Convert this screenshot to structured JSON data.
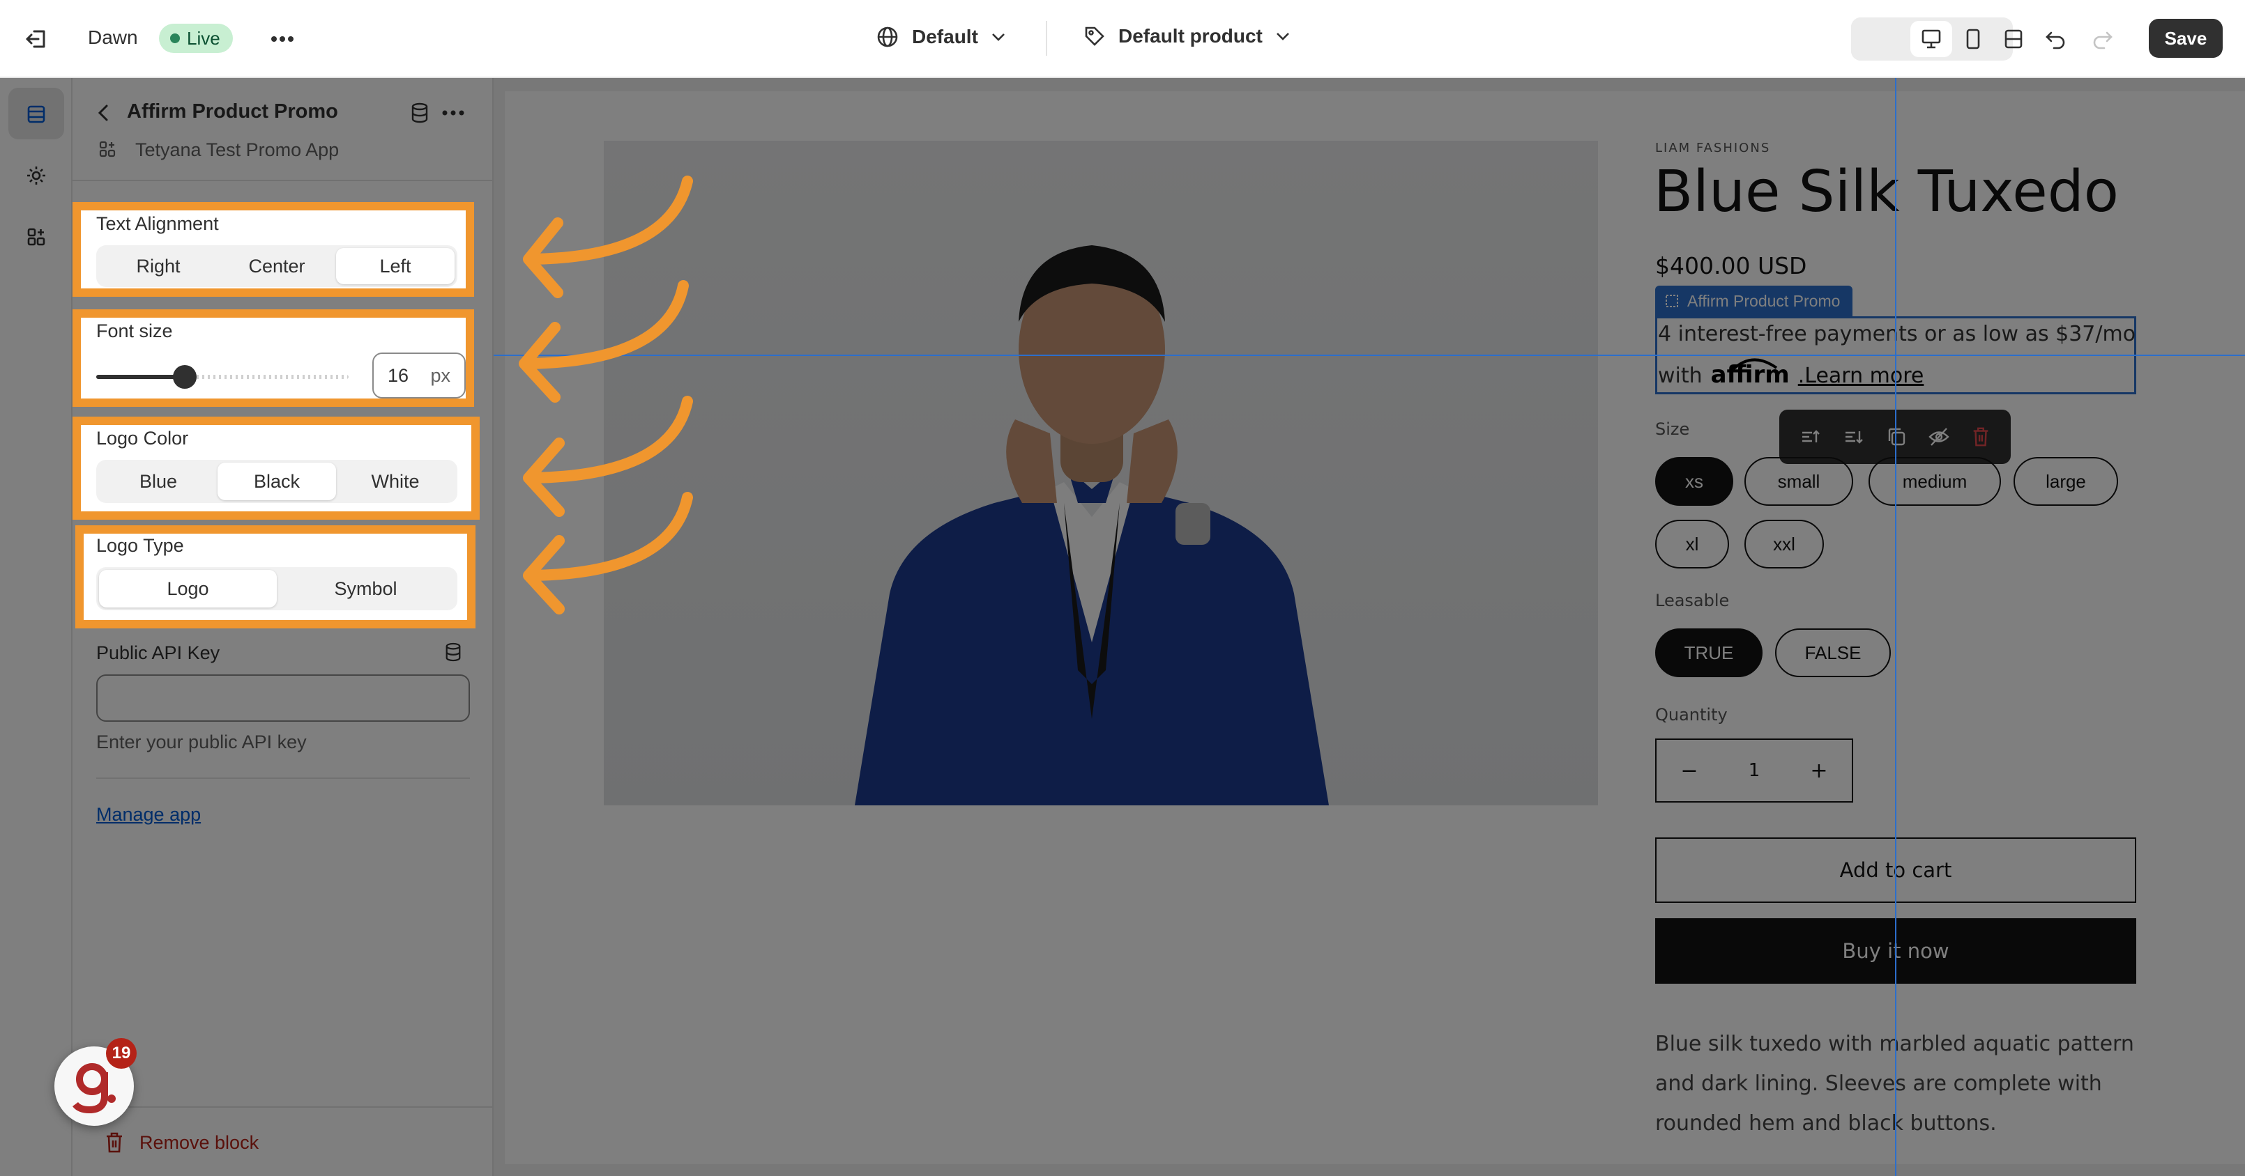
{
  "topbar": {
    "theme_name": "Dawn",
    "status_badge": "Live",
    "language_select": "Default",
    "template_select": "Default product",
    "save_label": "Save"
  },
  "panel": {
    "block_title": "Affirm Product Promo",
    "app_name": "Tetyana Test Promo App",
    "text_alignment": {
      "label": "Text Alignment",
      "options": [
        "Right",
        "Center",
        "Left"
      ],
      "selected": "Left"
    },
    "font_size": {
      "label": "Font size",
      "value": "16",
      "unit": "px",
      "slider_fraction": 0.35
    },
    "logo_color": {
      "label": "Logo Color",
      "options": [
        "Blue",
        "Black",
        "White"
      ],
      "selected": "Black"
    },
    "logo_type": {
      "label": "Logo Type",
      "options": [
        "Logo",
        "Symbol"
      ],
      "selected": "Logo"
    },
    "api_key": {
      "label": "Public API Key",
      "value": "",
      "hint": "Enter your public API key"
    },
    "manage_app": "Manage app",
    "remove_block": "Remove block"
  },
  "notification_badge": {
    "count": "19"
  },
  "product": {
    "vendor": "LIAM FASHIONS",
    "title": "Blue Silk Tuxedo",
    "price": "$400.00 USD",
    "block_tag": "Affirm Product Promo",
    "promo_line1": "4 interest-free payments or as low as $37/mo",
    "promo_with": "with",
    "affirm_logo": "affirm",
    "promo_link": ".Learn more",
    "size_label": "Size",
    "sizes": [
      "xs",
      "small",
      "medium",
      "large",
      "xl",
      "xxl"
    ],
    "size_selected": "xs",
    "leasable_label": "Leasable",
    "leasable_options": [
      "TRUE",
      "FALSE"
    ],
    "leasable_selected": "TRUE",
    "quantity_label": "Quantity",
    "quantity_value": "1",
    "quantity_minus": "−",
    "quantity_plus": "+",
    "add_to_cart": "Add to cart",
    "buy_now": "Buy it now",
    "description": [
      "Blue silk tuxedo with marbled aquatic pattern",
      "and dark lining. Sleeves are complete with",
      "rounded hem and black buttons."
    ]
  },
  "colors": {
    "accent_orange": "#f0962e",
    "live_green": "#29845a",
    "save_dark": "#303030",
    "guide_blue": "#2c6ecb"
  }
}
